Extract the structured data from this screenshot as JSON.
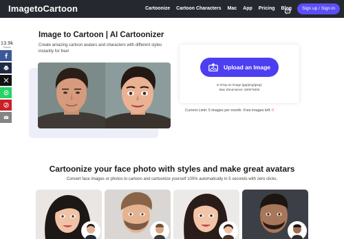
{
  "nav": {
    "logo": "ImagetoCartoon",
    "links": [
      "Cartoonize",
      "Cartoon Characters",
      "Mac",
      "App",
      "Pricing",
      "Blog"
    ],
    "chat_icon": "chat-bubble-icon",
    "signin_label": "Sign up / Sign in",
    "bg_color": "#25282e",
    "accent_color": "#5b4ff5"
  },
  "share": {
    "count": "13.9k",
    "sub": "Shares",
    "buttons": [
      {
        "icon": "facebook-icon",
        "color": "#3b5998"
      },
      {
        "icon": "print-icon",
        "color": "#1f2a44"
      },
      {
        "icon": "x-twitter-icon",
        "color": "#111111"
      },
      {
        "icon": "whatsapp-icon",
        "color": "#25d366"
      },
      {
        "icon": "pinterest-icon",
        "color": "#cb2027"
      },
      {
        "icon": "email-icon",
        "color": "#848484"
      }
    ]
  },
  "hero": {
    "title": "Image to Cartoon | AI Cartoonizer",
    "description": "Create amazing cartoon avatars and characters with different styles instantly for free!"
  },
  "upload": {
    "button_label": "Upload an Image",
    "drop_text": "or Drop an Image (jpg/png/jpeg);",
    "dimensions_text": "Max Dimensions: 5000*5000",
    "limit_text": "Current Limit: 5 images per month. Free images left:",
    "images_left": "0"
  },
  "section": {
    "title": "Cartoonize your face photo with styles and make great avatars",
    "description": "Convert face images or photos to cartoon and cartoonize yourself 100% automatically in 5 seconds with zero clicks."
  }
}
